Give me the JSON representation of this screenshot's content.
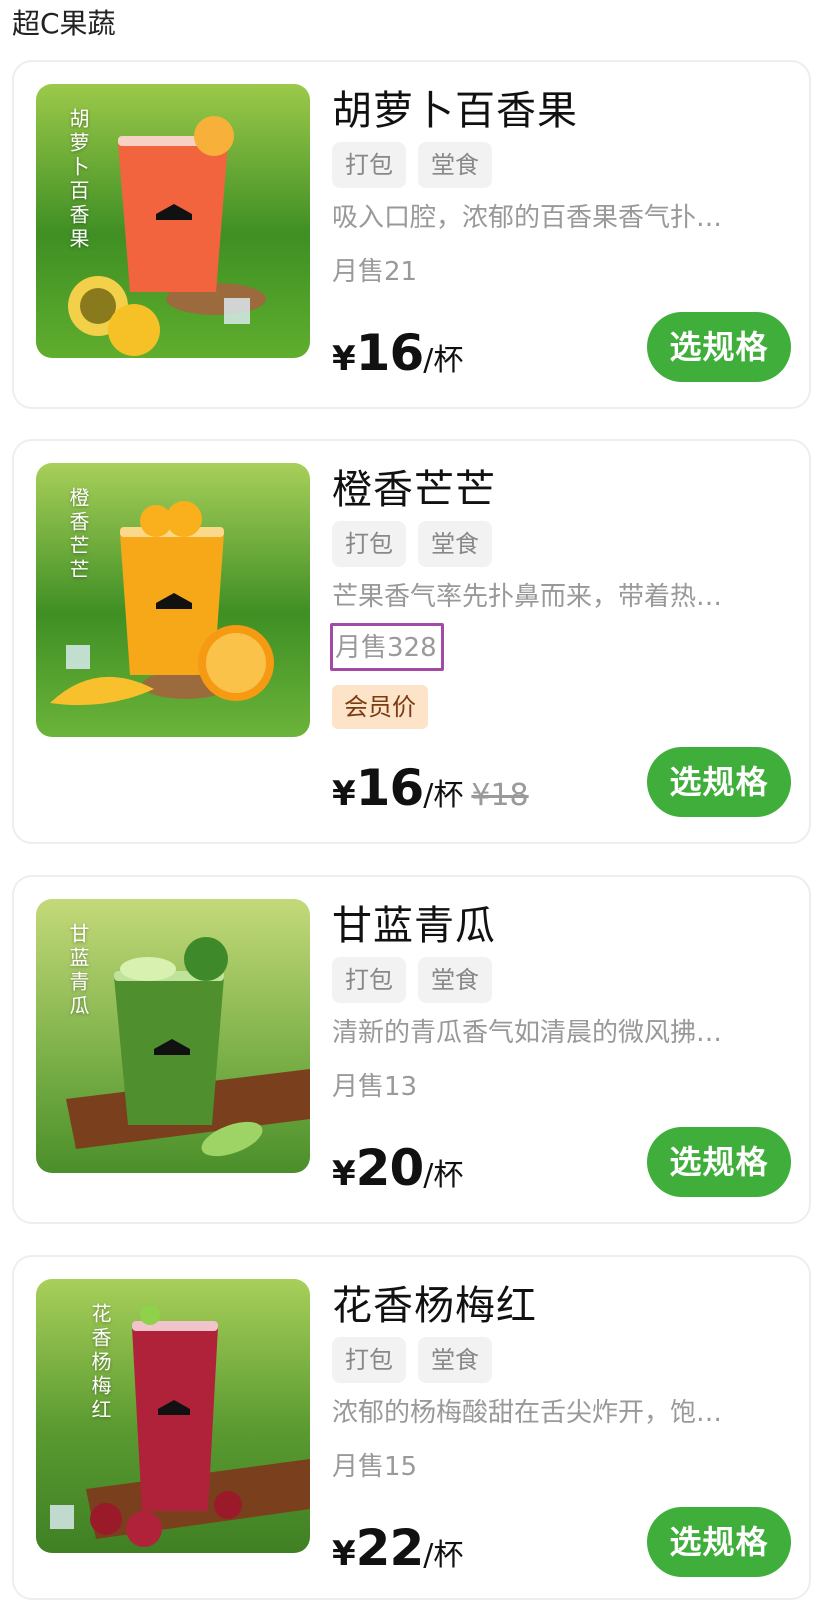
{
  "section": {
    "title": "超C果蔬"
  },
  "products": [
    {
      "name": "胡萝卜百香果",
      "caption": "胡萝卜百香果",
      "tags": [
        "打包",
        "堂食"
      ],
      "description": "吸入口腔，浓郁的百香果香气扑…",
      "sales": "月售21",
      "currency": "¥",
      "price": "16",
      "unit": "/杯",
      "button": "选规格",
      "drink_color": "#f2643e"
    },
    {
      "name": "橙香芒芒",
      "caption": "橙香芒芒",
      "tags": [
        "打包",
        "堂食"
      ],
      "description": "芒果香气率先扑鼻而来，带着热…",
      "sales": "月售328",
      "member_badge": "会员价",
      "currency": "¥",
      "price": "16",
      "unit": "/杯",
      "original_price": "¥18",
      "button": "选规格",
      "drink_color": "#f7a818"
    },
    {
      "name": "甘蓝青瓜",
      "caption": "甘蓝青瓜",
      "tags": [
        "打包",
        "堂食"
      ],
      "description": "清新的青瓜香气如清晨的微风拂…",
      "sales": "月售13",
      "currency": "¥",
      "price": "20",
      "unit": "/杯",
      "button": "选规格",
      "drink_color": "#4f8f2e"
    },
    {
      "name": "花香杨梅红",
      "caption": "花香杨梅红",
      "tags": [
        "打包",
        "堂食"
      ],
      "description": "浓郁的杨梅酸甜在舌尖炸开，饱…",
      "sales": "月售15",
      "currency": "¥",
      "price": "22",
      "unit": "/杯",
      "button": "选规格",
      "drink_color": "#b0223a"
    }
  ],
  "cup_brand": "YOHOTEA",
  "colors": {
    "accent_green": "#3fae3a",
    "highlight_border": "#a24aa6",
    "member_badge_bg": "#fde3c8"
  }
}
